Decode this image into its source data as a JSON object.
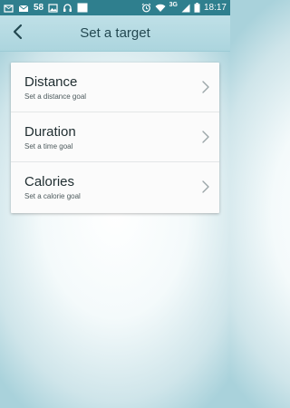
{
  "status_bar": {
    "notification_count": "58",
    "time": "18:17",
    "network": "3G",
    "left_icons": [
      "email-icon",
      "mail-icon",
      "image-icon",
      "headphones-icon",
      "blank-notification-icon"
    ],
    "right_icons": [
      "alarm-icon",
      "wifi-icon",
      "signal-icon",
      "battery-icon"
    ]
  },
  "header": {
    "title": "Set a target",
    "back_icon": "chevron-left-icon"
  },
  "targets": [
    {
      "title": "Distance",
      "subtitle": "Set a distance goal"
    },
    {
      "title": "Duration",
      "subtitle": "Set a time goal"
    },
    {
      "title": "Calories",
      "subtitle": "Set a calorie goal"
    }
  ],
  "colors": {
    "status_bar": "#2f7f8e",
    "app_bar": "#b5dbe3",
    "title_text": "#234851",
    "card": "#fbfbfb"
  }
}
